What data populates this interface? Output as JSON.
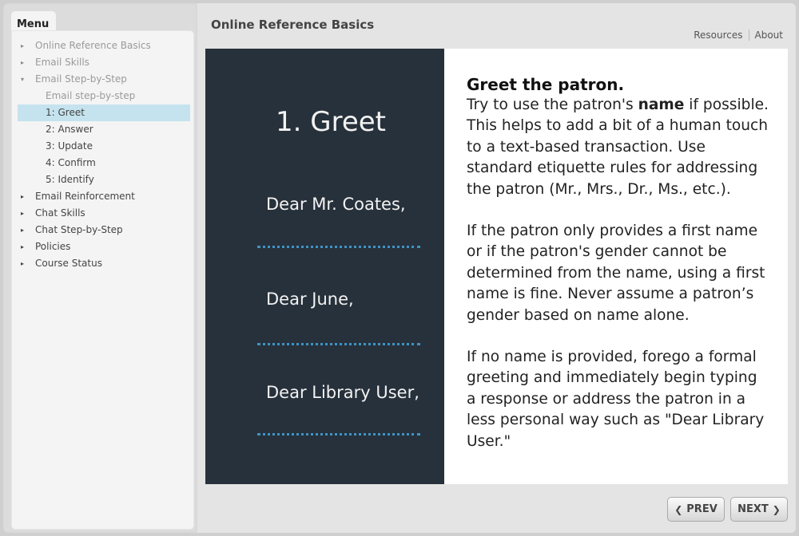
{
  "sidebar": {
    "tab_label": "Menu",
    "items": [
      {
        "label": "Online Reference Basics",
        "caret": "▸",
        "state": "dim"
      },
      {
        "label": "Email Skills",
        "caret": "▸",
        "state": "dim"
      },
      {
        "label": "Email Step-by-Step",
        "caret": "▾",
        "state": "dim"
      },
      {
        "label": "Email step-by-step",
        "caret": "",
        "state": "dim-sub"
      },
      {
        "label": "1: Greet",
        "caret": "",
        "state": "active"
      },
      {
        "label": "2: Answer",
        "caret": "",
        "state": "sub"
      },
      {
        "label": "3: Update",
        "caret": "",
        "state": "sub"
      },
      {
        "label": "4: Confirm",
        "caret": "",
        "state": "sub"
      },
      {
        "label": "5: Identify",
        "caret": "",
        "state": "sub"
      },
      {
        "label": "Email Reinforcement",
        "caret": "▸",
        "state": "normal"
      },
      {
        "label": "Chat Skills",
        "caret": "▸",
        "state": "normal"
      },
      {
        "label": "Chat Step-by-Step",
        "caret": "▸",
        "state": "normal"
      },
      {
        "label": "Policies",
        "caret": "▸",
        "state": "normal"
      },
      {
        "label": "Course Status",
        "caret": "▸",
        "state": "normal"
      }
    ]
  },
  "header": {
    "title": "Online Reference Basics",
    "links": [
      "Resources",
      "About"
    ]
  },
  "slide": {
    "step_title": "1. Greet",
    "greetings": [
      "Dear Mr. Coates,",
      "Dear June,",
      "Dear Library User,"
    ],
    "heading": "Greet the patron.",
    "p1_pre": "Try to use the patron's ",
    "p1_bold": "name",
    "p1_post": " if possible. This helps to add a bit of a human touch to a text-based transaction. Use standard etiquette rules for addressing the patron (Mr., Mrs., Dr., Ms., etc.).",
    "p2": "If the patron only provides a first name or if the patron's gender cannot be determined from the name, using a first name is fine. Never assume a patron’s gender based on name alone.",
    "p3": "If no name is provided, forego a formal greeting and immediately begin typing a response or address the patron in a less personal way such as \"Dear Library User.\""
  },
  "nav": {
    "prev_label": "PREV",
    "next_label": "NEXT"
  },
  "colors": {
    "dark_panel": "#27313b",
    "dotted_divider": "#3d94c6",
    "active_item": "#c4e3ee"
  }
}
